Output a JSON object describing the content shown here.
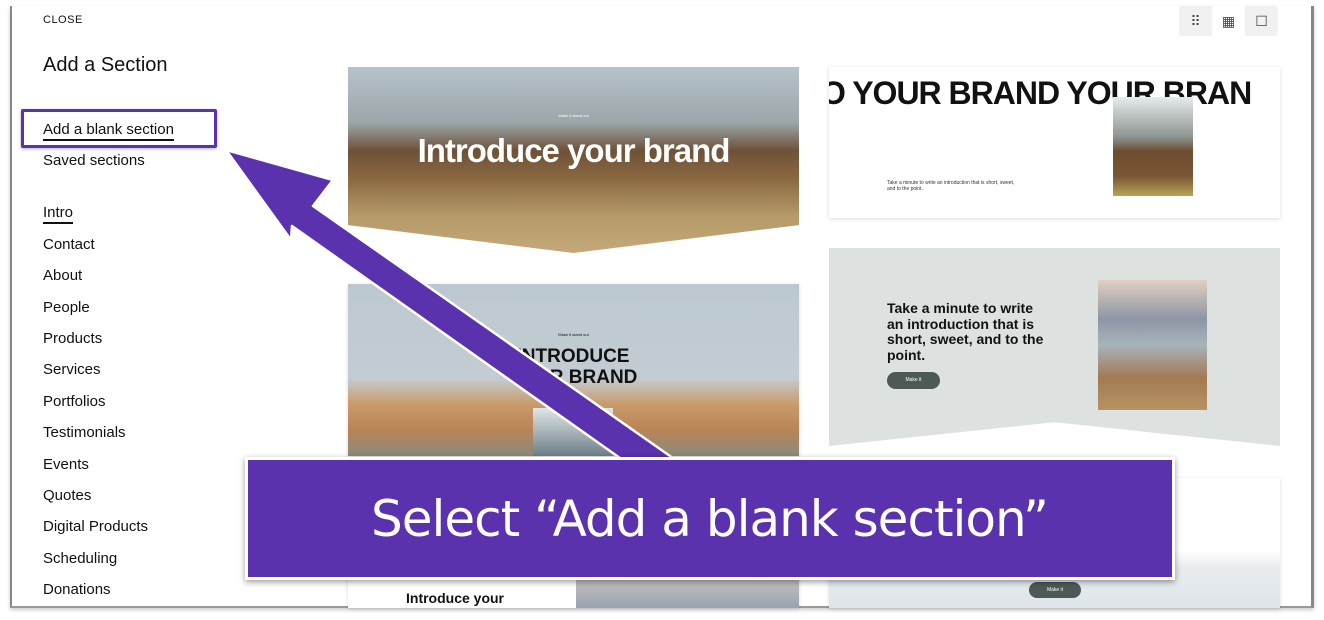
{
  "panel": {
    "close_label": "CLOSE",
    "title": "Add a Section",
    "primary_items": [
      "Add a blank section",
      "Saved sections"
    ],
    "categories": [
      "Intro",
      "Contact",
      "About",
      "People",
      "Products",
      "Services",
      "Portfolios",
      "Testimonials",
      "Events",
      "Quotes",
      "Digital Products",
      "Scheduling",
      "Donations"
    ],
    "active_category": "Intro"
  },
  "view_toggle": {
    "options": [
      "small-grid-icon",
      "grid-icon",
      "single-icon"
    ],
    "selected": "grid-icon"
  },
  "templates": {
    "t1": {
      "tagline": "Make it stand out",
      "heading": "Introduce your brand"
    },
    "t2": {
      "heading": "O YOUR BRAND  YOUR BRAN",
      "body": "Take a minute to write an introduction that is short, sweet, and to the point."
    },
    "t3": {
      "tagline": "Make it stand out",
      "heading": "INTRODUCE YOUR BRAND"
    },
    "t4": {
      "heading": "Take a minute to write an introduction that is short, sweet, and to the point.",
      "button": "Make it"
    },
    "t5": {
      "heading": "Introduce your"
    },
    "t6": {
      "button": "Make it"
    }
  },
  "annotation": {
    "text": "Select “Add a blank section”",
    "color": "#5a32ad"
  }
}
